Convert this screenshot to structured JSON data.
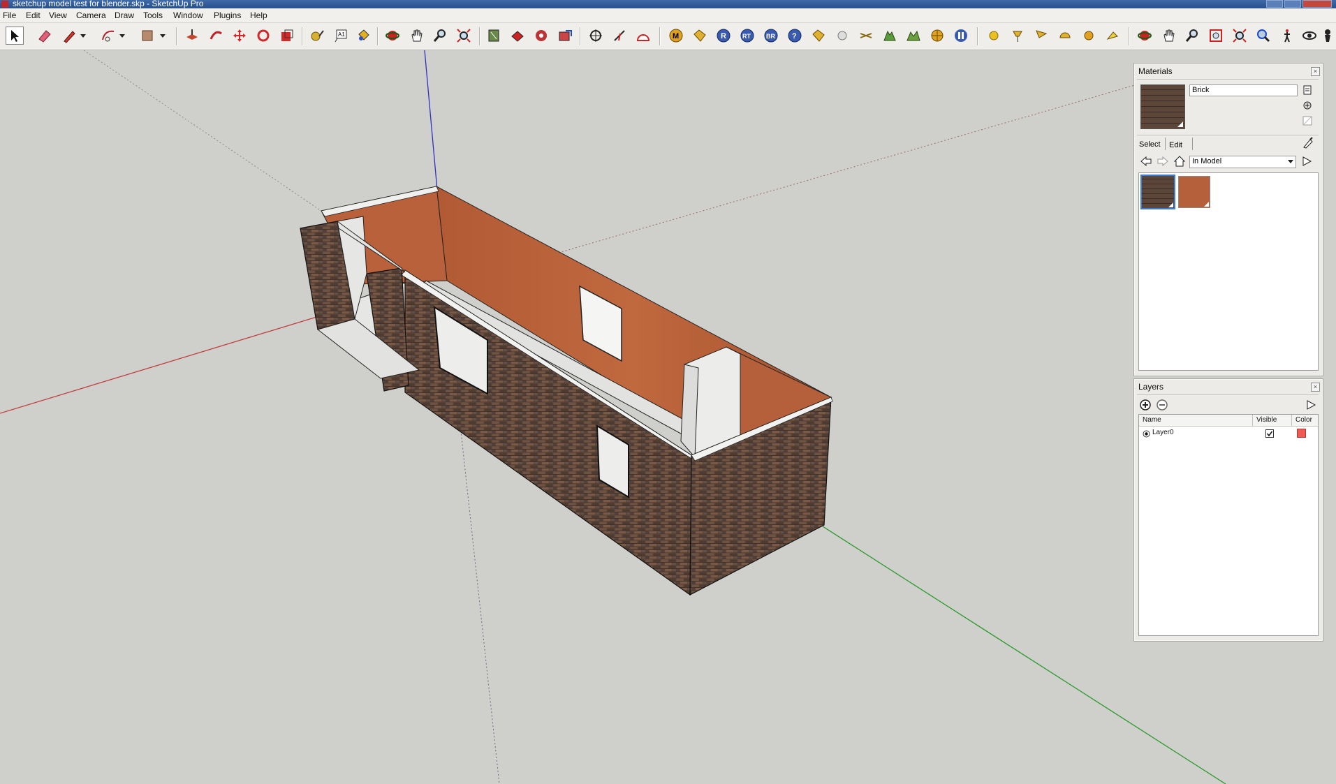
{
  "window": {
    "title": "sketchup model test for blender.skp - SketchUp Pro"
  },
  "menu": [
    "File",
    "Edit",
    "View",
    "Camera",
    "Draw",
    "Tools",
    "Window",
    "Plugins",
    "Help"
  ],
  "toolbar": {
    "tools": [
      "select-tool",
      "eraser-tool",
      "pencil-tool",
      "arc-tool",
      "rectangle-tool",
      "push-pull-tool",
      "follow-me-tool",
      "move-tool",
      "rotate-tool",
      "scale-tool",
      "tape-measure-tool",
      "text-tool",
      "paint-bucket-tool",
      "orbit-tool",
      "pan-tool",
      "zoom-tool",
      "zoom-extents-tool",
      "component-tool",
      "material-tool",
      "style-tool",
      "export-tool",
      "section-plane-tool",
      "axes-tool",
      "protractor-tool",
      "plugin-m",
      "plugin-tag",
      "plugin-r",
      "plugin-rt",
      "plugin-br",
      "plugin-help",
      "plugin-label",
      "plugin-sphere",
      "plugin-arrows",
      "plugin-tree",
      "plugin-trees",
      "plugin-target",
      "plugin-pause",
      "sun-tool",
      "lamp-tool",
      "flag-tool",
      "dome-tool",
      "light-tool",
      "spot-tool",
      "orbit2-tool",
      "pan2-tool",
      "zoom2-tool",
      "zoom-window-tool",
      "zoom-extents2-tool",
      "previous-view-tool",
      "walk-tool",
      "look-around-tool",
      "position-camera-tool"
    ]
  },
  "materials_panel": {
    "title": "Materials",
    "material_name": "Brick",
    "tab_select": "Select",
    "tab_edit": "Edit",
    "library_dropdown": "In Model",
    "swatches": [
      "brick-swatch",
      "wood-swatch"
    ],
    "colors": {
      "brick": "#5a4438",
      "wood": "#b5603a"
    }
  },
  "layers_panel": {
    "title": "Layers",
    "columns": {
      "name": "Name",
      "visible": "Visible",
      "color": "Color"
    },
    "layers": [
      {
        "name": "Layer0",
        "visible": true,
        "color": "#f05a52"
      }
    ]
  }
}
